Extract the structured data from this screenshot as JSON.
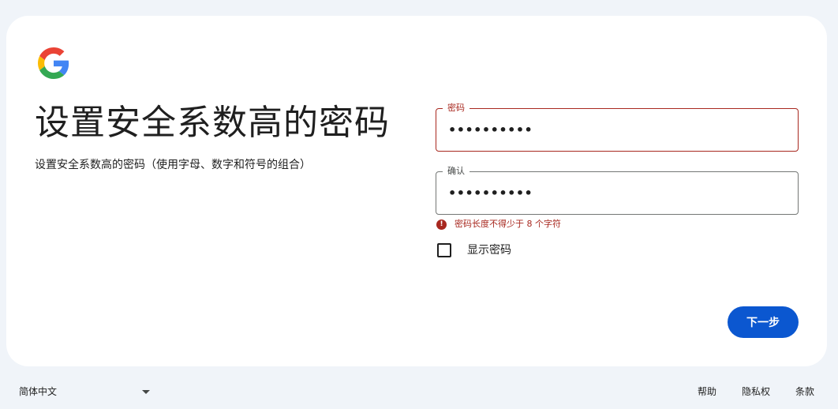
{
  "header": {
    "logo_icon": "google-g-logo",
    "title": "设置安全系数高的密码",
    "subtitle": "设置安全系数高的密码（使用字母、数字和符号的组合）"
  },
  "form": {
    "password": {
      "label": "密码",
      "value": "••••••••••"
    },
    "confirm": {
      "label": "确认",
      "value": "••••••••••"
    },
    "error": {
      "icon": "error-icon",
      "text": "密码长度不得少于 8 个字符"
    },
    "show_password": {
      "label": "显示密码",
      "checked": false
    },
    "next_label": "下一步"
  },
  "footer": {
    "language": "简体中文",
    "links": {
      "help": "帮助",
      "privacy": "隐私权",
      "terms": "条款"
    }
  },
  "colors": {
    "accent": "#0b57d0",
    "error": "#a8281f",
    "background": "#f0f4f9"
  }
}
